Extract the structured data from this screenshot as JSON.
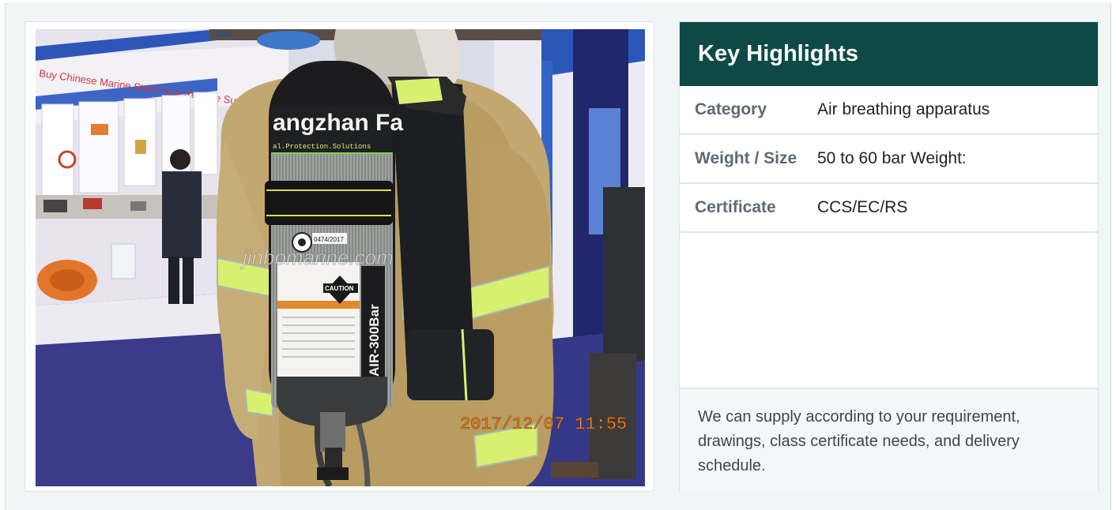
{
  "photo": {
    "banner_text": "Buy Chinese Marine Store Your Reliable Supplier",
    "brand_text": "SUN",
    "cylinder_brand": "angzhan Fa",
    "cylinder_tagline": "al.Protection.Solutions",
    "cylinder_label": "AIR-300Bar",
    "caution_label": "CAUTION",
    "cert_code": "0474/2017",
    "watermark": "jinbomarine.com",
    "timestamp": "2017/12/07  11:55"
  },
  "highlights": {
    "title": "Key Highlights",
    "rows": [
      {
        "label": "Category",
        "value": "Air breathing apparatus"
      },
      {
        "label": "Weight / Size",
        "value": "50 to 60 bar Weight:"
      },
      {
        "label": "Certificate",
        "value": "CCS/EC/RS"
      }
    ],
    "note": "We can supply according to your requirement, drawings, class certificate needs, and delivery schedule."
  },
  "colors": {
    "header_bg": "#0d4a45",
    "label_text": "#5d6b73",
    "page_bg": "#f1f5f6",
    "reflective_stripe": "#d8f070",
    "timestamp_orange": "#f08a24"
  }
}
